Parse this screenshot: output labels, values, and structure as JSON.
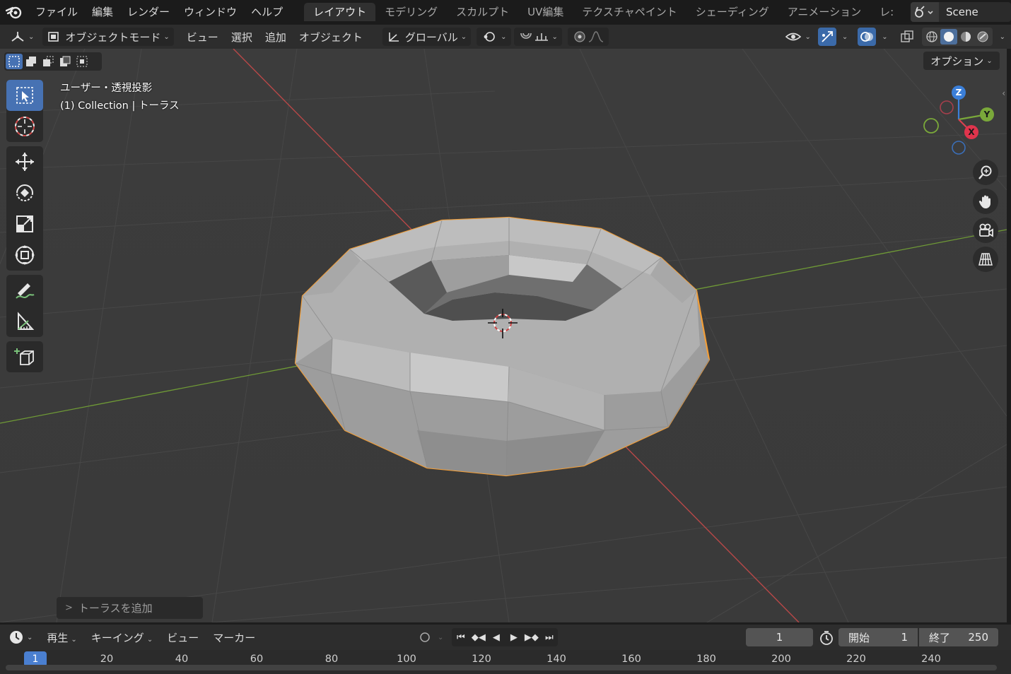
{
  "menu": {
    "items": [
      "ファイル",
      "編集",
      "レンダー",
      "ウィンドウ",
      "ヘルプ"
    ]
  },
  "workspaces": {
    "tabs": [
      "レイアウト",
      "モデリング",
      "スカルプト",
      "UV編集",
      "テクスチャペイント",
      "シェーディング",
      "アニメーション",
      "レ:"
    ],
    "active": "レイアウト"
  },
  "scene": {
    "name": "Scene"
  },
  "header": {
    "mode": "オブジェクトモード",
    "view": "ビュー",
    "select": "選択",
    "add": "追加",
    "object": "オブジェクト",
    "orientation": "グローバル"
  },
  "viewport": {
    "options": "オプション",
    "view_name": "ユーザー・透視投影",
    "collection_info": "(1) Collection | トーラス",
    "last_operation": "トーラスを追加"
  },
  "gizmo": {
    "x": "X",
    "y": "Y",
    "z": "Z"
  },
  "timeline": {
    "playback": "再生",
    "keying": "キーイング",
    "view": "ビュー",
    "marker": "マーカー",
    "current_frame": "1",
    "start_label": "開始",
    "start": "1",
    "end_label": "終了",
    "end": "250",
    "ruler_current": "1",
    "ruler": [
      "20",
      "40",
      "60",
      "80",
      "100",
      "120",
      "140",
      "160",
      "180",
      "200",
      "220",
      "240"
    ]
  },
  "colors": {
    "accent": "#4772b3",
    "selection_outline": "#f29e38",
    "x_axis": "#c84a4a",
    "y_axis": "#7aa83a",
    "z_axis": "#3b7fd9"
  }
}
